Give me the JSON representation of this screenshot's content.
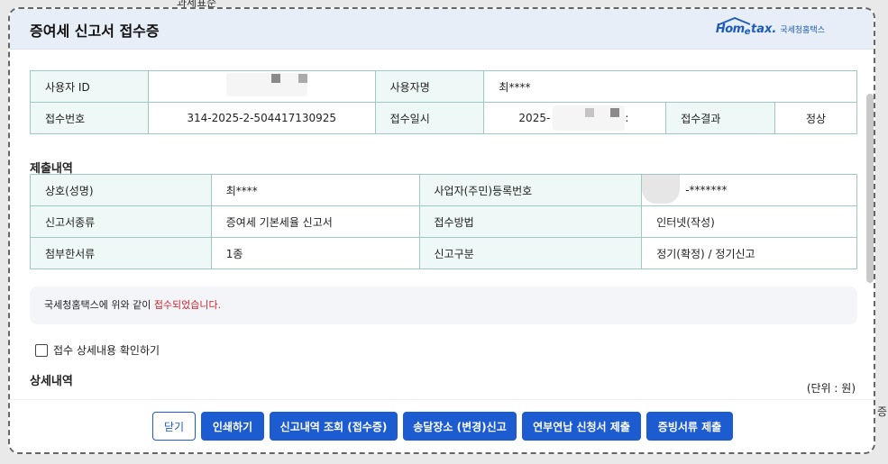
{
  "background": {
    "top_text": "과세표준",
    "right_text": "증"
  },
  "header": {
    "title": "증여세 신고서 접수증",
    "logo_home": "Hom",
    "logo_e": "e",
    "logo_tax": "tax.",
    "logo_sub": "국세청홈택스"
  },
  "top_table": {
    "user_id_label": "사용자 ID",
    "user_name_label": "사용자명",
    "user_name_value": "최****",
    "receipt_no_label": "접수번호",
    "receipt_no_value": "314-2025-2-504417130925",
    "receipt_date_label": "접수일시",
    "receipt_date_value": "2025-",
    "receipt_date_suffix": ":",
    "receipt_result_label": "접수결과",
    "receipt_result_value": "정상"
  },
  "submission": {
    "title": "제출내역",
    "rows": [
      {
        "label1": "상호(성명)",
        "value1": "최****",
        "label2": "사업자(주민)등록번호",
        "value2": "-*******"
      },
      {
        "label1": "신고서종류",
        "value1": "증여세 기본세율 신고서",
        "label2": "접수방법",
        "value2": "인터넷(작성)"
      },
      {
        "label1": "첨부한서류",
        "value1": "1종",
        "label2": "신고구분",
        "value2": "정기(확정) / 정기신고"
      }
    ]
  },
  "notice": {
    "text": "국세청홈택스에 위와 같이 ",
    "highlight": "접수되었습니다."
  },
  "check": {
    "label": "접수 상세내용 확인하기",
    "checked": false
  },
  "detail": {
    "title": "상세내역",
    "unit": "(단위 : 원)"
  },
  "buttons": {
    "close": "닫기",
    "print": "인쇄하기",
    "lookup": "신고내역 조회 (접수증)",
    "address": "송달장소 (변경)신고",
    "installment": "연부연납 신청서 제출",
    "evidence": "증빙서류 제출"
  },
  "colors": {
    "primary": "#1d5bd0",
    "header_bg": "#e8eef8",
    "table_border": "#9ec8c4",
    "table_header_bg": "#eef8f6",
    "notice_red": "#d0212a"
  }
}
